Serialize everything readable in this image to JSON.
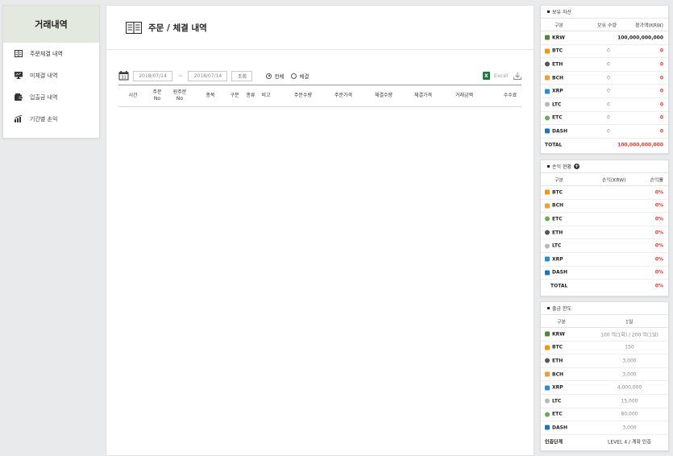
{
  "sidebar": {
    "title": "거래내역",
    "items": [
      {
        "label": "주문체결 내역",
        "icon": "ledger-icon"
      },
      {
        "label": "미체결 내역",
        "icon": "monitor-icon"
      },
      {
        "label": "입출금 내역",
        "icon": "wallet-icon"
      },
      {
        "label": "기간별 손익",
        "icon": "chart-icon"
      }
    ]
  },
  "main": {
    "title": "주문 / 체결 내역",
    "date_from": "2018/07/14",
    "date_sep": "~",
    "date_to": "2018/07/14",
    "search_label": "조회",
    "radio_all": "전체",
    "radio_filled": "체결",
    "excel_label": "Excel",
    "columns": [
      "시간",
      "주문\nNo",
      "원주문\nNo",
      "종목",
      "구분",
      "종류",
      "비고",
      "주문수량",
      "주문가격",
      "체결수량",
      "체결가격",
      "거래금액",
      "수수료"
    ]
  },
  "holdings": {
    "title": "보유 자산",
    "headers": [
      "구분",
      "보유 수량",
      "평가액(KRW)"
    ],
    "rows": [
      {
        "coin": "KRW",
        "qty": "",
        "value": "100,000,000,000"
      },
      {
        "coin": "BTC",
        "qty": "0",
        "value": "0"
      },
      {
        "coin": "ETH",
        "qty": "0",
        "value": "0"
      },
      {
        "coin": "BCH",
        "qty": "0",
        "value": "0"
      },
      {
        "coin": "XRP",
        "qty": "0",
        "value": "0"
      },
      {
        "coin": "LTC",
        "qty": "0",
        "value": "0"
      },
      {
        "coin": "ETC",
        "qty": "0",
        "value": "0"
      },
      {
        "coin": "DASH",
        "qty": "0",
        "value": "0"
      }
    ],
    "total_label": "TOTAL",
    "total_value": "100,000,000,000"
  },
  "profit": {
    "title": "손익 현황",
    "headers": [
      "구분",
      "손익(KRW)",
      "손익률"
    ],
    "rows": [
      {
        "coin": "BTC",
        "rate": "0%"
      },
      {
        "coin": "BCH",
        "rate": "0%"
      },
      {
        "coin": "ETC",
        "rate": "0%"
      },
      {
        "coin": "ETH",
        "rate": "0%"
      },
      {
        "coin": "LTC",
        "rate": "0%"
      },
      {
        "coin": "XRP",
        "rate": "0%"
      },
      {
        "coin": "DASH",
        "rate": "0%"
      }
    ],
    "total_label": "TOTAL",
    "total_rate": "0%"
  },
  "withdraw": {
    "title": "출금 한도",
    "headers": [
      "구분",
      "1일"
    ],
    "rows": [
      {
        "coin": "KRW",
        "limit": "100 억(1회) / 200 억(1일)"
      },
      {
        "coin": "BTC",
        "limit": "150"
      },
      {
        "coin": "ETH",
        "limit": "3,000"
      },
      {
        "coin": "BCH",
        "limit": "3,000"
      },
      {
        "coin": "XRP",
        "limit": "4,000,000"
      },
      {
        "coin": "LTC",
        "limit": "15,000"
      },
      {
        "coin": "ETC",
        "limit": "80,000"
      },
      {
        "coin": "DASH",
        "limit": "3,000"
      }
    ],
    "auth_label": "인증단계",
    "auth_value": "LEVEL 4 / 계좌 인증"
  },
  "coin_colors": {
    "KRW": "#4f8a3c",
    "BTC": "#f7931a",
    "ETH": "#555555",
    "BCH": "#f0a030",
    "XRP": "#2b8bd6",
    "LTC": "#b8b8b8",
    "ETC": "#6cab5a",
    "DASH": "#1c75bc"
  }
}
